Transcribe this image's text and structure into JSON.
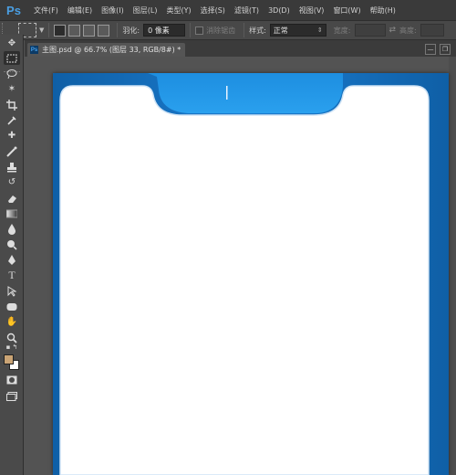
{
  "app": {
    "logo": "Ps"
  },
  "menu": [
    "文件(F)",
    "编辑(E)",
    "图像(I)",
    "图层(L)",
    "类型(Y)",
    "选择(S)",
    "滤镜(T)",
    "3D(D)",
    "视图(V)",
    "窗口(W)",
    "帮助(H)"
  ],
  "options": {
    "feather_label": "羽化:",
    "feather_value": "0 像素",
    "antialias_label": "消除锯齿",
    "style_label": "样式:",
    "style_value": "正常",
    "width_label": "宽度:",
    "height_label": "高度:"
  },
  "document": {
    "tab_label": "主图.psd @ 66.7% (图层 33, RGB/8#) *",
    "icon_label": "Ps"
  },
  "canvas": {
    "frame_color": "#1a73c4",
    "panel_color": "#ffffff",
    "accent_highlight": "#3aa2e6"
  },
  "colors": {
    "foreground": "#caa475",
    "background": "#ffffff"
  },
  "icons": {
    "close": "✕",
    "minimize": "—",
    "restore": "❐"
  }
}
